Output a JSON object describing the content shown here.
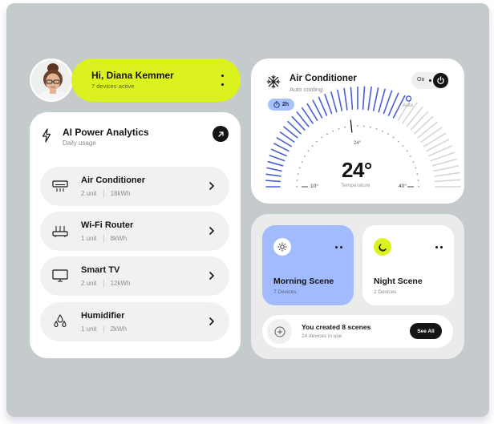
{
  "user": {
    "greeting": "Hi, Diana Kemmer",
    "devices_active": "7 devices active"
  },
  "analytics": {
    "title": "AI Power Analytics",
    "subtitle": "Daily usage",
    "devices": [
      {
        "name": "Air Conditioner",
        "units": "2 unit",
        "energy": "18kWh",
        "icon": "air-conditioner-icon"
      },
      {
        "name": "Wi-Fi Router",
        "units": "1 unit",
        "energy": "8kWh",
        "icon": "router-icon"
      },
      {
        "name": "Smart TV",
        "units": "2 unit",
        "energy": "12kWh",
        "icon": "tv-icon"
      },
      {
        "name": "Humidifier",
        "units": "1 unit",
        "energy": "2kWh",
        "icon": "humidifier-icon"
      }
    ]
  },
  "ac": {
    "title": "Air Conditioner",
    "subtitle": "Auto cooling",
    "toggle_label": "On",
    "timer": "2h",
    "gauge_min": "10°",
    "gauge_max": "40°",
    "gauge_mid": "24°",
    "auto_label": "Auto",
    "temperature": "24°",
    "temperature_label": "Temperature",
    "min_value": 10,
    "max_value": 40,
    "current_value": 24,
    "auto_value": 30
  },
  "scenes": {
    "morning": {
      "title": "Morning Scene",
      "subtitle": "7 Devices"
    },
    "night": {
      "title": "Night Scene",
      "subtitle": "2 Devices"
    },
    "created_title": "You created 8 scenes",
    "created_sub": "24 devices in use",
    "see_all": "See All"
  },
  "colors": {
    "accent_lime": "#dcf21e",
    "accent_blue": "#a2bbff",
    "gauge_blue": "#4a5fd6",
    "dark": "#141414"
  }
}
